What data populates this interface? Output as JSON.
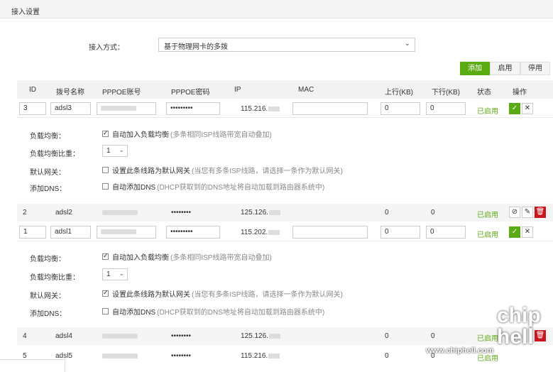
{
  "section_title": "接入设置",
  "access": {
    "label": "接入方式：",
    "selected": "基于物理网卡的多拨"
  },
  "actions": {
    "add": "添加",
    "enable": "启用",
    "disable": "停用"
  },
  "columns": {
    "id": "ID",
    "name": "拨号名称",
    "account": "PPPOE账号",
    "password": "PPPOE密码",
    "ip": "IP",
    "mac": "MAC",
    "up": "上行(KB)",
    "down": "下行(KB)",
    "status": "状态",
    "op": "操作"
  },
  "rows": [
    {
      "id": "3",
      "name": "adsl3",
      "password": "•••••••••",
      "ip": "115.216.",
      "up": "0",
      "down": "0",
      "status": "已启用"
    },
    {
      "id": "2",
      "name": "adsl2",
      "password": "••••••••",
      "ip": "125.126.",
      "up": "0",
      "down": "0",
      "status": "已启用"
    },
    {
      "id": "1",
      "name": "adsl1",
      "password": "•••••••••",
      "ip": "115.202.",
      "up": "0",
      "down": "0",
      "status": "已启用"
    },
    {
      "id": "4",
      "name": "adsl4",
      "password": "••••••••",
      "ip": "125.126.",
      "up": "0",
      "down": "0",
      "status": "已启用"
    },
    {
      "id": "5",
      "name": "adsl5",
      "password": "••••••••",
      "ip": "115.216.",
      "up": "0",
      "down": "0",
      "status": "已启用"
    }
  ],
  "detail_labels": {
    "lb": "负载均衡：",
    "ratio": "负载均衡比重：",
    "gw": "默认网关：",
    "dns": "添加DNS："
  },
  "detail1": {
    "lb_text": "自动加入负载均衡",
    "lb_hint": "(多条相同ISP线路带宽自动叠加)",
    "ratio": "1",
    "gw_text": "设置此条线路为默认网关",
    "gw_hint": "(当您有多条ISP线路，请选择一条作为默认网关)",
    "dns_text": "自动添加DNS",
    "dns_hint": "(DHCP获取到的DNS地址将自动加载到路由器系统中)"
  },
  "detail2": {
    "lb_text": "自动加入负载均衡",
    "lb_hint": "(多条相同ISP线路带宽自动叠加)",
    "ratio": "1",
    "gw_text": "设置此条线路为默认网关",
    "gw_hint": "(当您有多条ISP线路，请选择一条作为默认网关)",
    "dns_text": "自动添加DNS",
    "dns_hint": "(DHCP获取到的DNS地址将自动加载到路由器系统中)"
  },
  "watermark": "www.chiphell.com",
  "logo_text": "chip hell"
}
